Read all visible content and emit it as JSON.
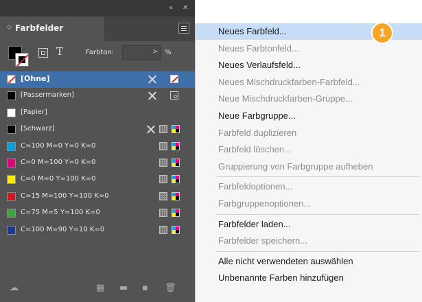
{
  "panel": {
    "tab_label": "Farbfelder",
    "tint_label": "Farbton:",
    "tint_value": "",
    "tint_unit": "%",
    "t_glyph": "T",
    "swatches": [
      {
        "name": "[Ohne]",
        "color": "none",
        "selected": true,
        "icons": [
          "x-icon",
          "none-icon"
        ]
      },
      {
        "name": "[Passermarken]",
        "color": "#000000",
        "selected": false,
        "icons": [
          "x-icon",
          "registration-icon"
        ]
      },
      {
        "name": "[Papier]",
        "color": "#ffffff",
        "selected": false,
        "icons": []
      },
      {
        "name": "[Schwarz]",
        "color": "#000000",
        "selected": false,
        "icons": [
          "x-icon",
          "process-icon",
          "cmyk-icon"
        ]
      },
      {
        "name": "C=100 M=0 Y=0 K=0",
        "color": "#00a3e0",
        "selected": false,
        "icons": [
          "process-icon",
          "cmyk-icon"
        ]
      },
      {
        "name": "C=0 M=100 Y=0 K=0",
        "color": "#e5007e",
        "selected": false,
        "icons": [
          "process-icon",
          "cmyk-icon"
        ]
      },
      {
        "name": "C=0 M=0 Y=100 K=0",
        "color": "#ffec00",
        "selected": false,
        "icons": [
          "process-icon",
          "cmyk-icon"
        ]
      },
      {
        "name": "C=15 M=100 Y=100 K=0",
        "color": "#d7141f",
        "selected": false,
        "icons": [
          "process-icon",
          "cmyk-icon"
        ]
      },
      {
        "name": "C=75 M=5 Y=100 K=0",
        "color": "#3aa935",
        "selected": false,
        "icons": [
          "process-icon",
          "cmyk-icon"
        ]
      },
      {
        "name": "C=100 M=90 Y=10 K=0",
        "color": "#1d3a8f",
        "selected": false,
        "icons": [
          "process-icon",
          "cmyk-icon"
        ]
      }
    ]
  },
  "menu": {
    "items": [
      {
        "label": "Neues Farbfeld...",
        "enabled": true,
        "highlighted": true
      },
      {
        "label": "Neues Farbtonfeld...",
        "enabled": false
      },
      {
        "label": "Neues Verlaufsfeld...",
        "enabled": true
      },
      {
        "label": "Neues Mischdruckfarben-Farbfeld...",
        "enabled": false
      },
      {
        "label": "Neue Mischdruckfarben-Gruppe...",
        "enabled": false
      },
      {
        "label": "Neue Farbgruppe...",
        "enabled": true
      },
      {
        "label": "Farbfeld duplizieren",
        "enabled": false
      },
      {
        "label": "Farbfeld löschen...",
        "enabled": false
      },
      {
        "label": "Gruppierung von Farbgruppe aufheben",
        "enabled": false,
        "separator_after": true
      },
      {
        "label": "Farbfeldoptionen...",
        "enabled": false
      },
      {
        "label": "Farbgruppenoptionen...",
        "enabled": false,
        "separator_after": true
      },
      {
        "label": "Farbfelder laden...",
        "enabled": true
      },
      {
        "label": "Farbfelder speichern...",
        "enabled": false,
        "separator_after": true
      },
      {
        "label": "Alle nicht verwendeten auswählen",
        "enabled": true
      },
      {
        "label": "Unbenannte Farben hinzufügen",
        "enabled": true
      }
    ]
  },
  "badge": {
    "label": "1",
    "color": "#f6a623"
  },
  "colors": {
    "panel_bg": "#535353",
    "selection": "#3e6fa8",
    "menu_bg": "#f6f6f6",
    "menu_highlight": "#c6dcf7"
  }
}
